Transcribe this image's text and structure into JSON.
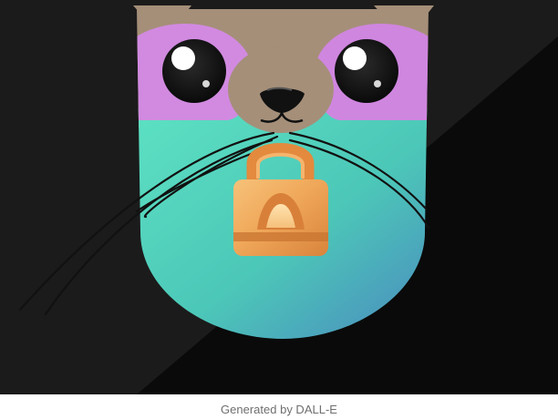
{
  "figure": {
    "caption": "Generated by DALL-E",
    "colors": {
      "background_dark": "#1b1b1b",
      "background_darker": "#090909",
      "fur": "#a58f79",
      "eye_patch": "#d18ae0",
      "lower_face_start": "#55d8bd",
      "lower_face_end": "#4a8fbd",
      "lock": "#f0a85a",
      "whisker": "#111111"
    }
  }
}
